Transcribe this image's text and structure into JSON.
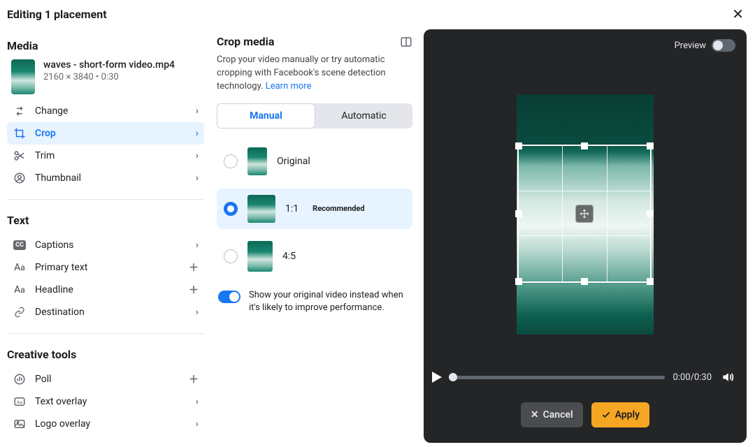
{
  "header": {
    "title": "Editing 1 placement"
  },
  "sidebar": {
    "media_title": "Media",
    "file": {
      "name": "waves - short-form video.mp4",
      "meta": "2160 × 3840 • 0:30"
    },
    "items": [
      {
        "id": "change",
        "label": "Change",
        "tail": "chev"
      },
      {
        "id": "crop",
        "label": "Crop",
        "tail": "chev",
        "selected": true
      },
      {
        "id": "trim",
        "label": "Trim",
        "tail": "chev"
      },
      {
        "id": "thumbnail",
        "label": "Thumbnail",
        "tail": "chev"
      }
    ],
    "text_title": "Text",
    "text_items": [
      {
        "id": "captions",
        "label": "Captions",
        "tail": "chev"
      },
      {
        "id": "primary-text",
        "label": "Primary text",
        "tail": "plus"
      },
      {
        "id": "headline",
        "label": "Headline",
        "tail": "plus"
      },
      {
        "id": "destination",
        "label": "Destination",
        "tail": "chev"
      }
    ],
    "tools_title": "Creative tools",
    "tool_items": [
      {
        "id": "poll",
        "label": "Poll",
        "tail": "plus"
      },
      {
        "id": "text-overlay",
        "label": "Text overlay",
        "tail": "chev"
      },
      {
        "id": "logo-overlay",
        "label": "Logo overlay",
        "tail": "chev"
      }
    ]
  },
  "mid": {
    "title": "Crop media",
    "desc": "Crop your video manually or try automatic cropping with Facebook's scene detection technology. ",
    "learn_more": "Learn more",
    "tabs": {
      "manual": "Manual",
      "automatic": "Automatic"
    },
    "options": {
      "original": {
        "label": "Original"
      },
      "one_one": {
        "label": "1:1",
        "badge": "Recommended"
      },
      "four_five": {
        "label": "4:5"
      }
    },
    "show_original_text": "Show your original video instead when it's likely to improve performance."
  },
  "preview": {
    "label": "Preview",
    "time": "0:00/0:30",
    "cancel": "Cancel",
    "apply": "Apply"
  }
}
